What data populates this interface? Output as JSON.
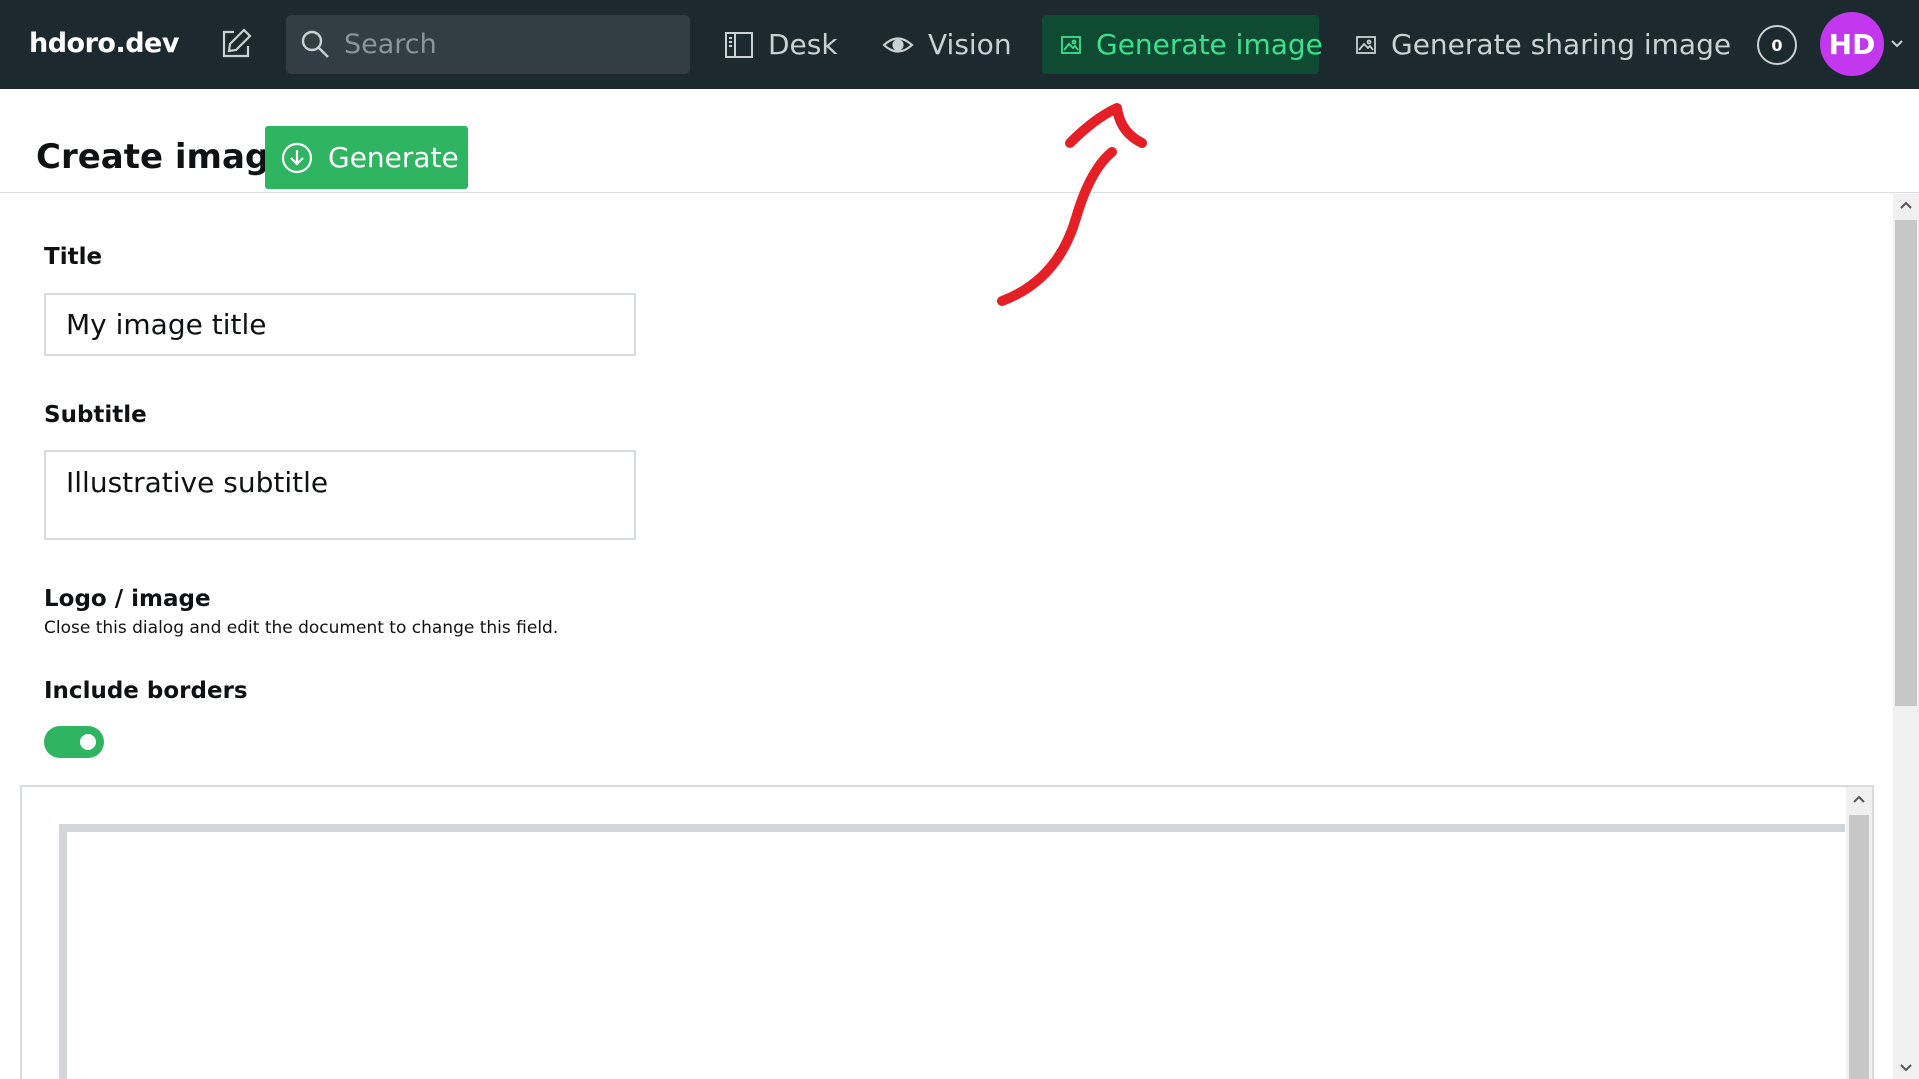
{
  "navbar": {
    "brand": "hdoro.dev",
    "search_placeholder": "Search",
    "items": [
      {
        "label": "Desk",
        "icon": "desk-icon"
      },
      {
        "label": "Vision",
        "icon": "eye-icon"
      },
      {
        "label": "Generate image",
        "icon": "image-icon",
        "active": true
      },
      {
        "label": "Generate sharing image",
        "icon": "image-icon"
      }
    ],
    "notification_count": "0",
    "avatar_initials": "HD"
  },
  "dialog": {
    "title": "Create image",
    "generate_label": "Generate"
  },
  "form": {
    "title_label": "Title",
    "title_value": "My image title",
    "subtitle_label": "Subtitle",
    "subtitle_value": "Illustrative subtitle",
    "logo_label": "Logo / image",
    "logo_description": "Close this dialog and edit the document to change this field.",
    "borders_label": "Include borders",
    "borders_enabled": true
  },
  "colors": {
    "navbar_bg": "#1c2a30",
    "active_bg": "#0f4a32",
    "active_text": "#3ee08e",
    "primary_green": "#2fb461",
    "avatar_bg": "#c338ee",
    "annotation_red": "#e41f26"
  }
}
